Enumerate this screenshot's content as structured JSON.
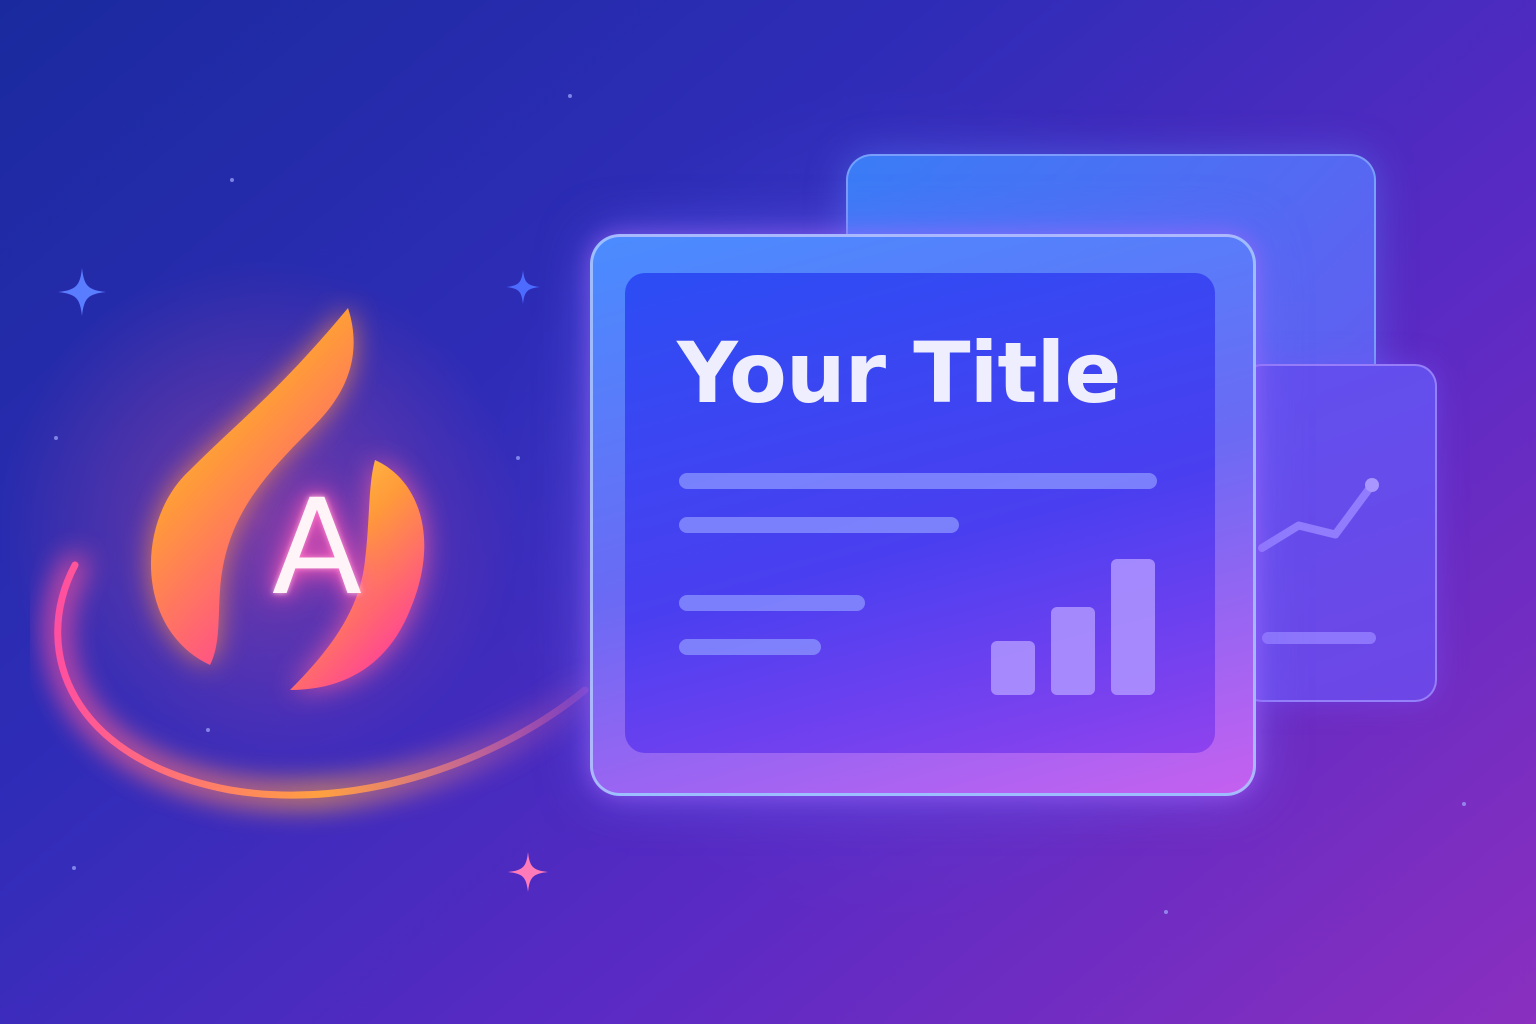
{
  "slide": {
    "title": "Your Title"
  },
  "logo": {
    "letter": "A",
    "icon": "flame-icon"
  },
  "colors": {
    "flame_core": "#ffd24a",
    "flame_edge": "#ff3f9a",
    "background_top": "#1a2a9e",
    "background_bottom": "#8a2fbf",
    "card_accent": "#4a8cff"
  },
  "chart_data": {
    "type": "bar",
    "categories": [
      "",
      "",
      ""
    ],
    "values": [
      40,
      65,
      100
    ],
    "ylim": [
      0,
      100
    ]
  },
  "side_chart": {
    "type": "line",
    "values": [
      20,
      45,
      35,
      90
    ]
  }
}
